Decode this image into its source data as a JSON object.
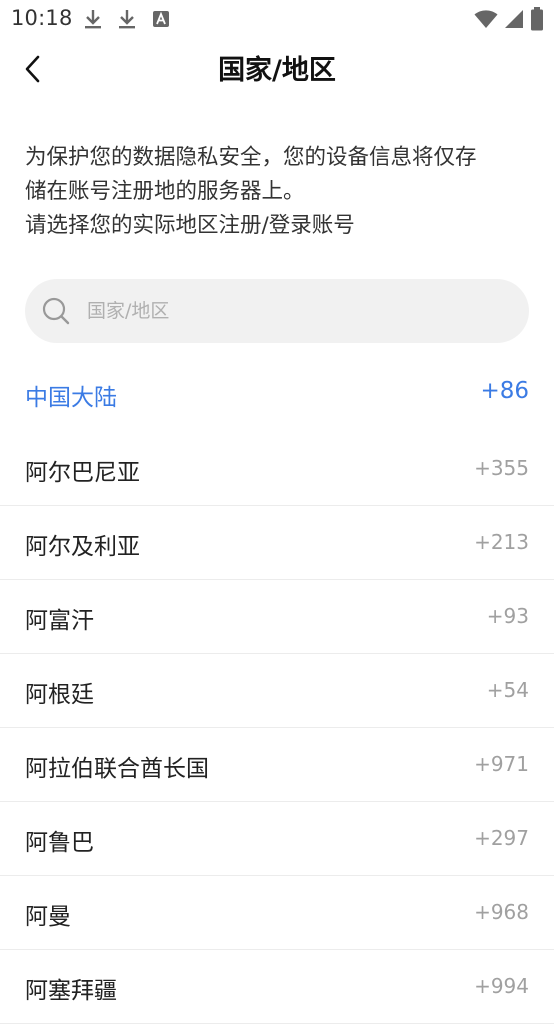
{
  "status_bar": {
    "time": "10:18"
  },
  "header": {
    "title": "国家/地区"
  },
  "intro": {
    "lines": [
      "为保护您的数据隐私安全，您的设备信息将仅存",
      "储在账号注册地的服务器上。",
      "请选择您的实际地区注册/登录账号"
    ]
  },
  "search": {
    "placeholder": "国家/地区"
  },
  "selected": {
    "name": "中国大陆",
    "code": "+86",
    "color": "#3b7be4"
  },
  "countries": [
    {
      "name": "阿尔巴尼亚",
      "code": "+355"
    },
    {
      "name": "阿尔及利亚",
      "code": "+213"
    },
    {
      "name": "阿富汗",
      "code": "+93"
    },
    {
      "name": "阿根廷",
      "code": "+54"
    },
    {
      "name": "阿拉伯联合酋长国",
      "code": "+971"
    },
    {
      "name": "阿鲁巴",
      "code": "+297"
    },
    {
      "name": "阿曼",
      "code": "+968"
    },
    {
      "name": "阿塞拜疆",
      "code": "+994"
    }
  ]
}
